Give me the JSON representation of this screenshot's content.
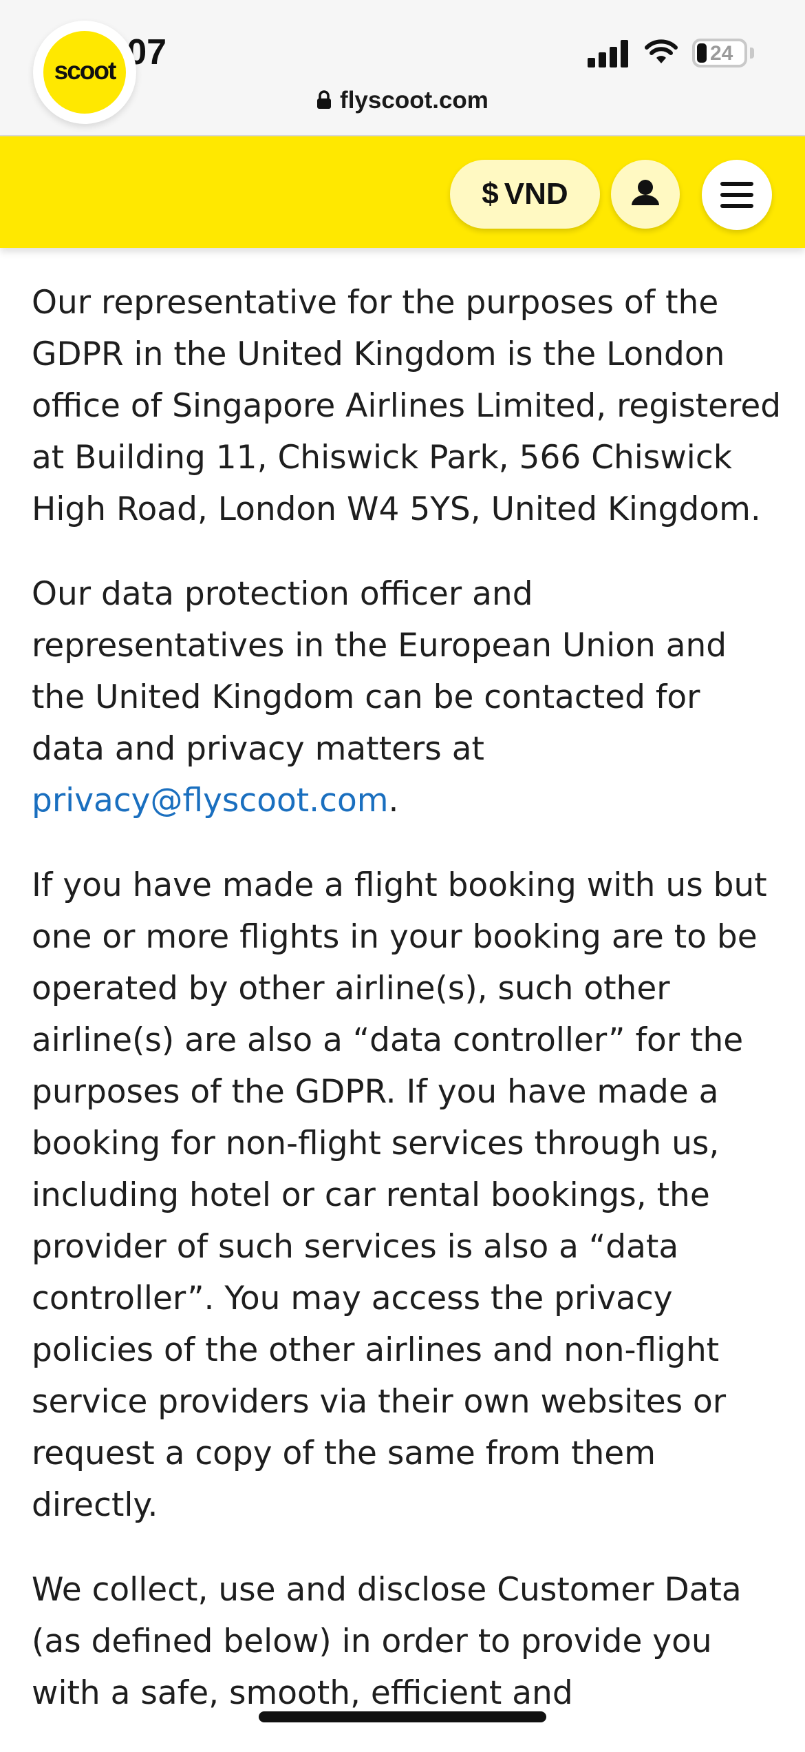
{
  "status": {
    "time": "5:07",
    "battery": "24",
    "url": "flyscoot.com"
  },
  "nav": {
    "logo": "scoot",
    "currency_symbol": "$",
    "currency": "VND"
  },
  "content": {
    "p1": "Our representative for the purposes of the GDPR in the United Kingdom is the London office of Singapore Airlines Limited, registered at Building 11, Chiswick Park, 566 Chiswick High Road, London W4 5YS, United Kingdom.",
    "p2_before": "Our data protection officer and representatives in the European Union and the United Kingdom can be contacted for data and privacy matters at ",
    "p2_link": "privacy@flyscoot.com",
    "p2_after": ".",
    "p3": "If you have made a flight booking with us but one or more flights in your booking are to be operated by other airline(s), such other airline(s) are also a “data controller” for the purposes of the GDPR. If you have made a booking for non-flight services through us, including hotel or car rental bookings, the provider of such services is also a “data controller”. You may access the privacy policies of the other airlines and non-flight service providers via their own websites or request a copy of the same from them directly.",
    "p4": "We collect, use and disclose Customer Data (as defined below) in order to provide you with a safe, smooth, efficient and"
  },
  "colors": {
    "brand_yellow": "#ffe800",
    "link_blue": "#1a6fbf"
  },
  "icons": [
    "signal-icon",
    "wifi-icon",
    "battery-icon",
    "lock-icon",
    "user-icon",
    "menu-icon"
  ]
}
